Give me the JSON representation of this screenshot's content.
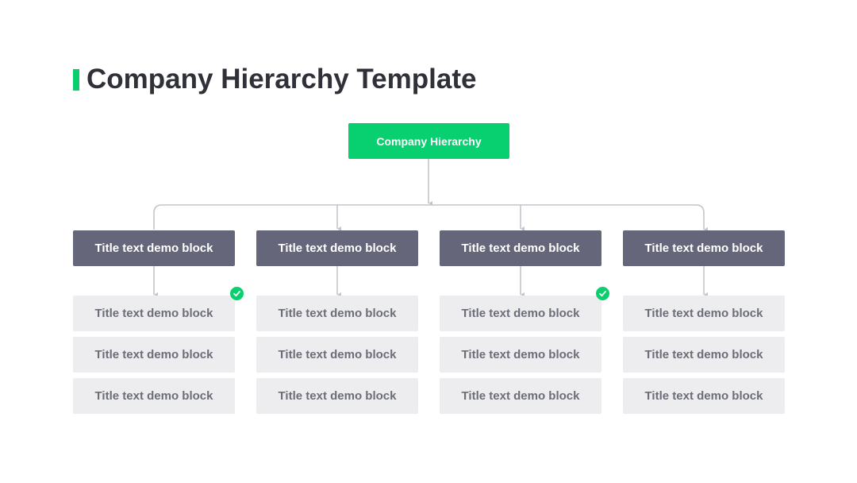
{
  "title": "Company Hierarchy Template",
  "root": {
    "label": "Company Hierarchy"
  },
  "columns": [
    {
      "header": "Title text demo block",
      "items": [
        "Title text demo block",
        "Title text demo block",
        "Title text demo block"
      ],
      "checked": true
    },
    {
      "header": "Title text demo block",
      "items": [
        "Title text demo block",
        "Title text demo block",
        "Title text demo block"
      ],
      "checked": false
    },
    {
      "header": "Title text demo block",
      "items": [
        "Title text demo block",
        "Title text demo block",
        "Title text demo block"
      ],
      "checked": true
    },
    {
      "header": "Title text demo block",
      "items": [
        "Title text demo block",
        "Title text demo block",
        "Title text demo block"
      ],
      "checked": false
    }
  ],
  "icons": {
    "check": "check-circle-icon"
  },
  "colors": {
    "accent": "#0acf6e",
    "header_block": "#656679",
    "item_block": "#ededef",
    "connector": "#c4c5cb",
    "title_text": "#2f3038"
  }
}
